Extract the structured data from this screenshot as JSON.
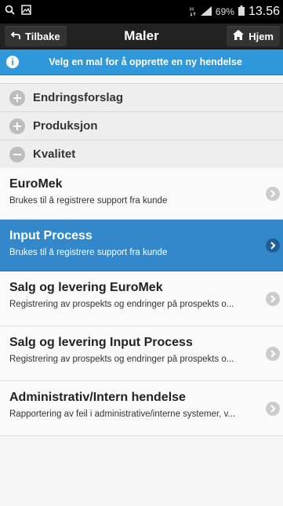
{
  "status": {
    "battery": "69%",
    "time": "13.56"
  },
  "header": {
    "back_label": "Tilbake",
    "title": "Maler",
    "home_label": "Hjem"
  },
  "info": {
    "text": "Velg en mal for å opprette en ny hendelse"
  },
  "groups": [
    {
      "label": "Endringsforslag",
      "state": "collapsed"
    },
    {
      "label": "Produksjon",
      "state": "collapsed"
    },
    {
      "label": "Kvalitet",
      "state": "expanded"
    }
  ],
  "items": [
    {
      "title": "EuroMek",
      "subtitle": "Brukes til å registrere support fra kunde"
    },
    {
      "title": "Input Process",
      "subtitle": "Brukes til å registrere support fra kunde"
    },
    {
      "title": "Salg og levering EuroMek",
      "subtitle": "Registrering av prospekts og endringer på prospekts o..."
    },
    {
      "title": "Salg og levering Input Process",
      "subtitle": "Registrering av prospekts og endringer på prospekts o..."
    },
    {
      "title": "Administrativ/Intern hendelse",
      "subtitle": "Rapportering av feil i administrative/interne systemer, v..."
    }
  ],
  "colors": {
    "header": "#222222",
    "info": "#2e98db",
    "active": "#3388cc"
  }
}
